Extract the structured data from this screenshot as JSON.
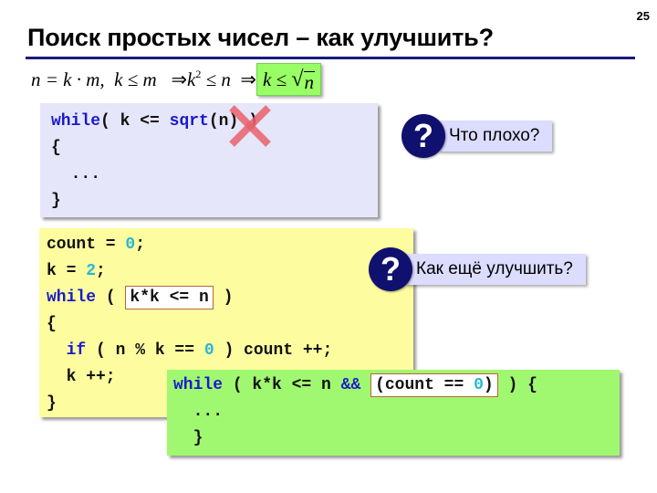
{
  "slide": {
    "page_number": "25",
    "title": "Поиск простых чисел – как улучшить?"
  },
  "formula": {
    "part1": "n = k · m,",
    "part2": "k ≤ m",
    "arrow": "⇒",
    "part3_base": "k",
    "part3_exp": "2",
    "part3_rest": " ≤ n",
    "highlight_lhs": "k ≤ ",
    "highlight_radical": "√",
    "highlight_radicand": "n"
  },
  "code_block_1": {
    "lines": {
      "l1_kw": "while",
      "l1_a": "( k <= ",
      "l1_fn": "sqrt",
      "l1_b": "(n) )",
      "l2": "{",
      "l3": "  ...",
      "l4": "}"
    },
    "crossed_out": "sqrt"
  },
  "code_block_2": {
    "l1_a": "count = ",
    "l1_num": "0",
    "l1_b": ";",
    "l2_a": "k = ",
    "l2_num": "2",
    "l2_b": ";",
    "l3_kw": "while",
    "l3_a": " ( ",
    "l3_framed": "k*k <= n",
    "l3_b": " )",
    "l4": "{",
    "l5_indent": "  ",
    "l5_kw": "if",
    "l5_a": " ( n % k == ",
    "l5_num": "0",
    "l5_b": " ) count ++;",
    "l6": "  k ++;",
    "l7": "}"
  },
  "code_block_3": {
    "l1_kw": "while",
    "l1_a": " ( k*k <= n ",
    "l1_op": "&&",
    "l1_framed_a": "(count == ",
    "l1_framed_num": "0",
    "l1_framed_b": ")",
    "l1_b": " ) {",
    "l2": "  ...",
    "l3": "  }"
  },
  "questions": [
    {
      "icon": "?",
      "label": "Что плохо?"
    },
    {
      "icon": "?",
      "label": "Как ещё улучшить?"
    }
  ],
  "colors": {
    "keyword": "#1a1acc",
    "number": "#2ab5d8",
    "title_rule": "#1a1a80",
    "question_icon": "#10106e",
    "cross": "#e8606a"
  }
}
